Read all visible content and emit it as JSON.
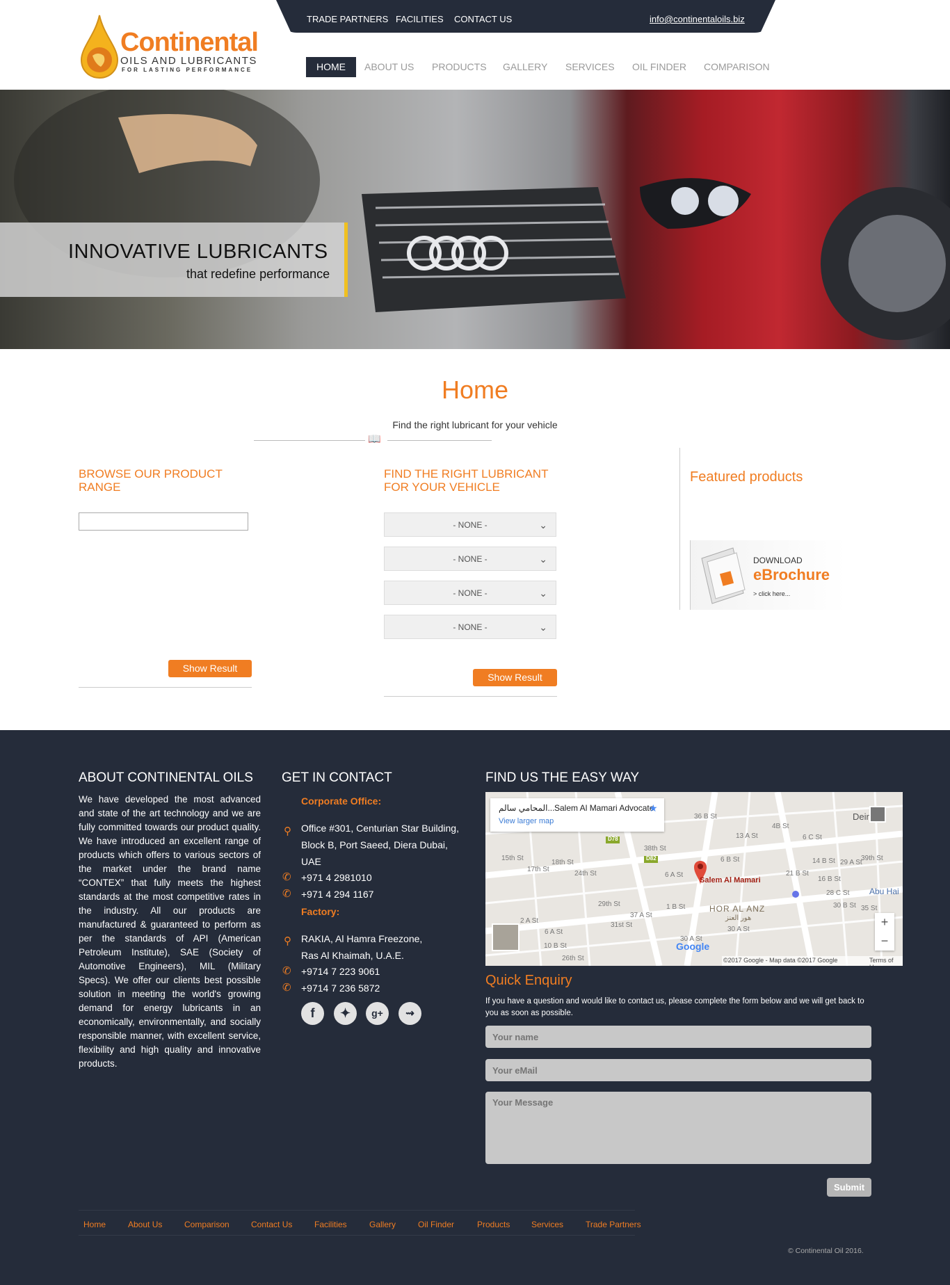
{
  "header": {
    "top_links": [
      "TRADE PARTNERS",
      "FACILITIES",
      "CONTACT US"
    ],
    "email": "info@continentaloils.biz",
    "logo": {
      "name": "Continental",
      "sub": "OILS AND LUBRICANTS",
      "tag": "FOR LASTING PERFORMANCE"
    },
    "nav": [
      "HOME",
      "ABOUT US",
      "PRODUCTS",
      "GALLERY",
      "SERVICES",
      "OIL FINDER",
      "COMPARISON"
    ]
  },
  "hero": {
    "title": "INNOVATIVE LUBRICANTS",
    "subtitle": "that redefine performance"
  },
  "main": {
    "title": "Home",
    "subtitle": "Find the right lubricant for your vehicle",
    "browse_title": "BROWSE OUR PRODUCT RANGE",
    "browse_input": "",
    "finder_title": "FIND THE RIGHT LUBRICANT FOR YOUR VEHICLE",
    "selects": [
      "- NONE -",
      "- NONE -",
      "- NONE -",
      "- NONE -"
    ],
    "show_result": "Show Result",
    "featured_title": "Featured products",
    "brochure": {
      "download": "DOWNLOAD",
      "title": "eBrochure",
      "click": "> click here..."
    }
  },
  "footer": {
    "about_title": "ABOUT CONTINENTAL OILS",
    "about_text": "We have developed the most advanced and state of the art technology and we are fully committed towards our product quality. We have introduced an excellent range of products which offers to various sectors of the market under the brand name “CONTEX” that fully meets the highest standards at the most competitive rates in the industry. All our products are manufactured & guaranteed to perform as per the standards of API (American Petroleum Institute), SAE (Society of Automotive Engineers), MIL (Military Specs). We offer our clients best possible solution in meeting the world's growing demand for energy lubricants in an economically, environmentally, and socially responsible manner, with excellent service, flexibility and high quality and innovative products.",
    "contact_title": "GET IN CONTACT",
    "corporate_label": "Corporate Office:",
    "corporate_address": "Office #301, Centurian Star Building, Block B, Port Saeed, Diera Dubai, UAE",
    "corporate_phones": [
      "+971 4 2981010",
      "+971 4 294 1167"
    ],
    "factory_label": "Factory:",
    "factory_address": "RAKIA, Al Hamra Freezone, Ras Al Khaimah, U.A.E.",
    "factory_phones": [
      "+9714 7 223 9061",
      "+9714 7 236 5872"
    ],
    "social_icons": [
      "facebook-icon",
      "twitter-icon",
      "google-plus-icon",
      "rss-icon"
    ],
    "map_title": "FIND US THE EASY WAY",
    "map": {
      "place": "Salem Al Mamari Advocate",
      "place_ar": "المحامي سالم...",
      "view_larger": "View larger map",
      "pin_label": "Salem Al Mamari",
      "district": "HOR AL ANZ",
      "district_ar": "هور العنز",
      "deira": "Deira",
      "abu_hail": "Abu Hai",
      "streets": [
        "15th St",
        "17th St",
        "18th St",
        "24th St",
        "29th St",
        "31st St",
        "37 A St",
        "38th St",
        "36 B St",
        "13 A St",
        "4B St",
        "6 C St",
        "6 B St",
        "6 A St",
        "1 B St",
        "16 B St",
        "14 B St",
        "21 B St",
        "29 A St",
        "39th St",
        "28 C St",
        "30 B St",
        "35 St",
        "2 A St",
        "6 A St",
        "10 B St",
        "30 A St",
        "30 A St",
        "26th St"
      ],
      "roads": [
        "D78",
        "D82"
      ],
      "zoom_in": "+",
      "zoom_out": "−",
      "google": "Google",
      "attribution": "©2017 Google - Map data ©2017 Google",
      "terms": "Terms of Use"
    },
    "enquiry_title": "Quick Enquiry",
    "enquiry_text": "If you have a question and would like to contact us, please complete the form below and we will get back to you as soon as possible.",
    "name_placeholder": "Your name",
    "email_placeholder": "Your eMail",
    "message_placeholder": "Your Message",
    "submit": "Submit",
    "nav": [
      "Home",
      "About Us",
      "Comparison",
      "Contact Us",
      "Facilities",
      "Gallery",
      "Oil Finder",
      "Products",
      "Services",
      "Trade Partners"
    ],
    "copyright": "© Continental Oil 2016."
  }
}
